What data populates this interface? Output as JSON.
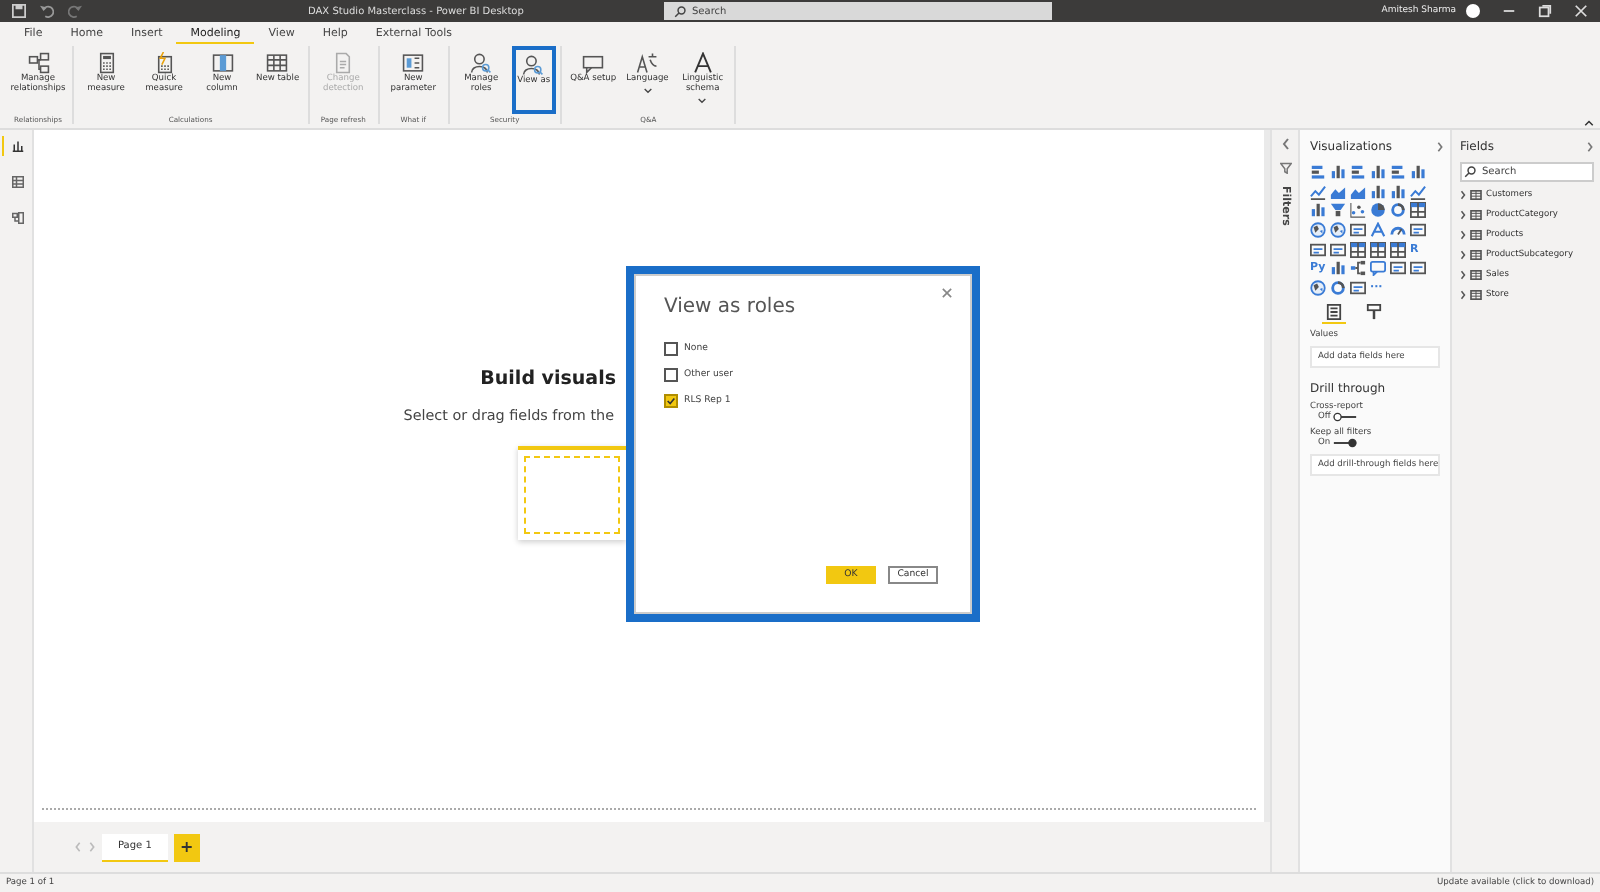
{
  "window": {
    "title": "DAX Studio Masterclass - Power BI Desktop",
    "search": {
      "placeholder": "Search"
    },
    "user": "Amitesh Sharma"
  },
  "menu_tabs": [
    {
      "label": "File",
      "selected": false
    },
    {
      "label": "Home",
      "selected": false
    },
    {
      "label": "Insert",
      "selected": false
    },
    {
      "label": "Modeling",
      "selected": true
    },
    {
      "label": "View",
      "selected": false
    },
    {
      "label": "Help",
      "selected": false
    },
    {
      "label": "External Tools",
      "selected": false
    }
  ],
  "ribbon_groups": [
    {
      "label": "Relationships",
      "buttons": [
        {
          "label": "Manage relationships",
          "kind": "relationships",
          "disabled": false,
          "highlighted": false,
          "dropdown": false
        }
      ]
    },
    {
      "label": "Calculations",
      "buttons": [
        {
          "label": "New measure",
          "kind": "calculator",
          "disabled": false,
          "highlighted": false,
          "dropdown": false
        },
        {
          "label": "Quick measure",
          "kind": "quick",
          "disabled": false,
          "highlighted": false,
          "dropdown": false
        },
        {
          "label": "New column",
          "kind": "column",
          "disabled": false,
          "highlighted": false,
          "dropdown": false
        },
        {
          "label": "New table",
          "kind": "table",
          "disabled": false,
          "highlighted": false,
          "dropdown": false
        }
      ]
    },
    {
      "label": "Page refresh",
      "buttons": [
        {
          "label": "Change detection",
          "kind": "document",
          "disabled": true,
          "highlighted": false,
          "dropdown": false
        }
      ]
    },
    {
      "label": "What if",
      "buttons": [
        {
          "label": "New parameter",
          "kind": "parameter",
          "disabled": false,
          "highlighted": false,
          "dropdown": false
        }
      ]
    },
    {
      "label": "Security",
      "buttons": [
        {
          "label": "Manage roles",
          "kind": "person",
          "disabled": false,
          "highlighted": false,
          "dropdown": false
        },
        {
          "label": "View as",
          "kind": "person",
          "disabled": false,
          "highlighted": true,
          "dropdown": false
        }
      ]
    },
    {
      "label": "Q&A",
      "buttons": [
        {
          "label": "Q&A setup",
          "kind": "chat",
          "disabled": false,
          "highlighted": false,
          "dropdown": false
        },
        {
          "label": "Language",
          "kind": "language",
          "disabled": false,
          "highlighted": false,
          "dropdown": true
        },
        {
          "label": "Linguistic schema",
          "kind": "letter",
          "disabled": false,
          "highlighted": false,
          "dropdown": true
        }
      ]
    }
  ],
  "left_rail": [
    {
      "kind": "report",
      "selected": true
    },
    {
      "kind": "data",
      "selected": false
    },
    {
      "kind": "model",
      "selected": false
    }
  ],
  "canvas": {
    "heading": "Build visuals",
    "subtext": "Select or drag fields from the"
  },
  "dialog": {
    "title": "View as roles",
    "options": [
      {
        "label": "None",
        "checked": false
      },
      {
        "label": "Other user",
        "checked": false
      },
      {
        "label": "RLS Rep 1",
        "checked": true
      }
    ],
    "buttons": [
      {
        "label": "OK",
        "primary": true
      },
      {
        "label": "Cancel",
        "primary": false
      }
    ]
  },
  "pages": {
    "tabs": [
      {
        "label": "Page 1",
        "selected": true
      }
    ],
    "add": "+"
  },
  "filters": {
    "label": "Filters"
  },
  "visualizations": {
    "title": "Visualizations",
    "icons": [
      {
        "kind": "bars"
      },
      {
        "kind": "columns"
      },
      {
        "kind": "bars"
      },
      {
        "kind": "columns"
      },
      {
        "kind": "bars"
      },
      {
        "kind": "columns"
      },
      {
        "kind": "line"
      },
      {
        "kind": "area"
      },
      {
        "kind": "area"
      },
      {
        "kind": "columns"
      },
      {
        "kind": "columns"
      },
      {
        "kind": "line"
      },
      {
        "kind": "columns"
      },
      {
        "kind": "funnel"
      },
      {
        "kind": "scatter"
      },
      {
        "kind": "pie"
      },
      {
        "kind": "donut"
      },
      {
        "kind": "grid"
      },
      {
        "kind": "map"
      },
      {
        "kind": "map"
      },
      {
        "kind": "card"
      },
      {
        "kind": "arc"
      },
      {
        "kind": "gauge"
      },
      {
        "kind": "card"
      },
      {
        "kind": "card"
      },
      {
        "kind": "card"
      },
      {
        "kind": "grid"
      },
      {
        "kind": "grid"
      },
      {
        "kind": "grid"
      },
      {
        "kind": "glyph",
        "label": "R"
      },
      {
        "kind": "glyph",
        "label": "Py"
      },
      {
        "kind": "columns"
      },
      {
        "kind": "tree"
      },
      {
        "kind": "chat"
      },
      {
        "kind": "card"
      },
      {
        "kind": "card"
      },
      {
        "kind": "map"
      },
      {
        "kind": "donut"
      },
      {
        "kind": "card"
      },
      {
        "kind": "glyph",
        "label": "···"
      }
    ],
    "build_tabs": [
      {
        "kind": "fields",
        "selected": true
      },
      {
        "kind": "format",
        "selected": false
      }
    ],
    "values_label": "Values",
    "values_placeholder": "Add data fields here",
    "drill_title": "Drill through",
    "toggles": [
      {
        "label": "Cross-report",
        "state": "Off",
        "on": false
      },
      {
        "label": "Keep all filters",
        "state": "On",
        "on": true
      }
    ],
    "drill_placeholder": "Add drill-through fields here"
  },
  "fields": {
    "title": "Fields",
    "search": {
      "placeholder": "Search"
    },
    "tables": [
      {
        "name": "Customers",
        "expanded": false
      },
      {
        "name": "ProductCategory",
        "expanded": false
      },
      {
        "name": "Products",
        "expanded": false
      },
      {
        "name": "ProductSubcategory",
        "expanded": false
      },
      {
        "name": "Sales",
        "expanded": false
      },
      {
        "name": "Store",
        "expanded": false
      }
    ]
  },
  "status_bar": {
    "left": "Page 1 of 1",
    "right": "Update available (click to download)"
  }
}
